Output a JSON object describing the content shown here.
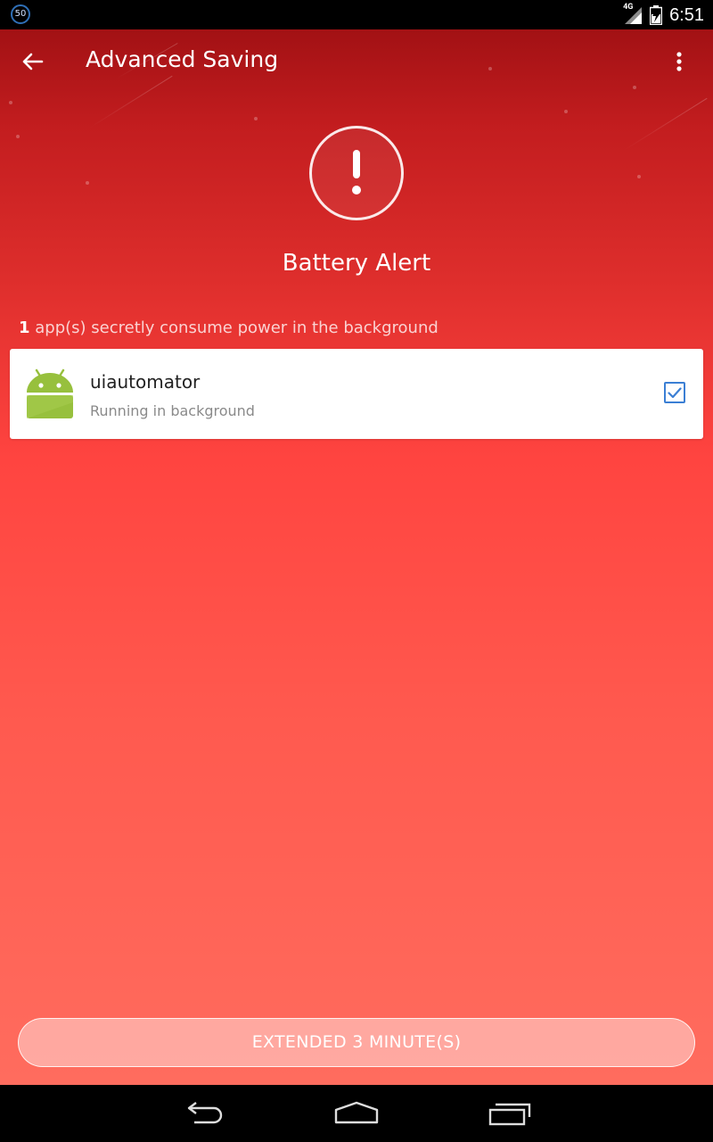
{
  "status_bar": {
    "left_badge": "50",
    "network": "4G",
    "time": "6:51",
    "icons": [
      "notification-badge-icon",
      "signal-icon",
      "battery-icon"
    ]
  },
  "toolbar": {
    "title": "Advanced Saving",
    "back_icon": "arrow-back-icon",
    "menu_icon": "more-vert-icon"
  },
  "alert": {
    "icon": "exclamation-icon",
    "title": "Battery Alert"
  },
  "summary": {
    "count": "1",
    "text": " app(s) secretly consume power in the background"
  },
  "apps": [
    {
      "name": "uiautomator",
      "status": "Running in background",
      "icon": "android-icon",
      "checked": true
    }
  ],
  "action": {
    "label": "EXTENDED 3 MINUTE(S)"
  },
  "nav": {
    "back": "nav-back-icon",
    "home": "nav-home-icon",
    "recents": "nav-recents-icon"
  },
  "colors": {
    "accent_red": "#ff4440",
    "checkbox_blue": "#3b7fd4",
    "android_green": "#97c03d"
  }
}
